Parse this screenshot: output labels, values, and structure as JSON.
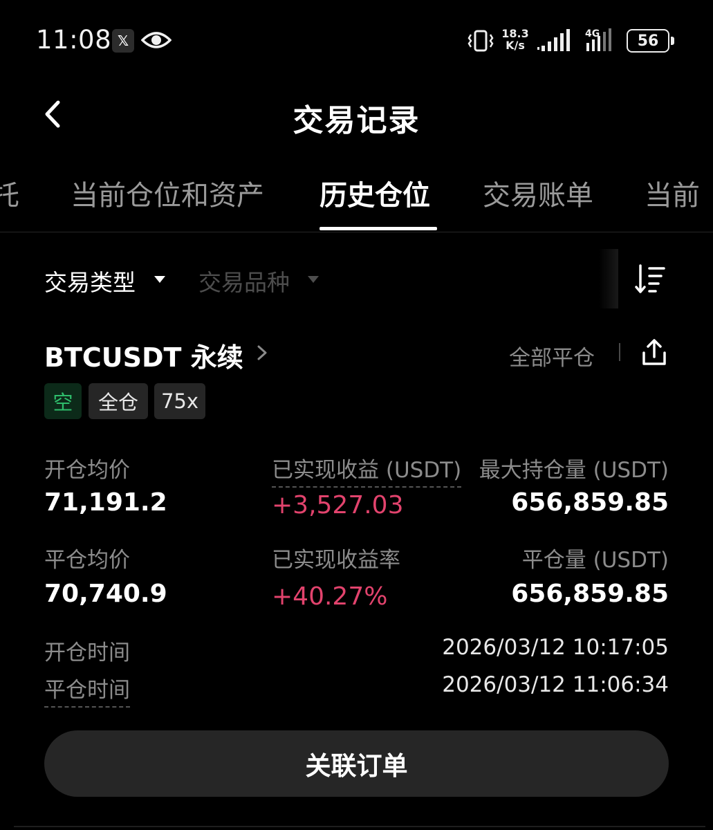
{
  "status_bar": {
    "time": "11:08",
    "app_badge": "𝕏",
    "net_speed_value": "18.3",
    "net_speed_unit": "K/s",
    "network_type": "4G",
    "battery": "56"
  },
  "header": {
    "title": "交易记录",
    "back_icon": "chevron-left-icon"
  },
  "tabs": [
    {
      "label": "托",
      "active": false
    },
    {
      "label": "当前仓位和资产",
      "active": false
    },
    {
      "label": "历史仓位",
      "active": true
    },
    {
      "label": "交易账单",
      "active": false
    },
    {
      "label": "当前",
      "active": false
    }
  ],
  "filters": {
    "trade_type": "交易类型",
    "trade_symbol": "交易品种",
    "sort_icon": "sort-descending-icon"
  },
  "position": {
    "symbol": "BTCUSDT 永续",
    "close_all": "全部平仓",
    "tags": [
      "空",
      "全仓",
      "75x"
    ],
    "open_avg_price_label": "开仓均价",
    "open_avg_price": "71,191.2",
    "realized_pnl_label": "已实现收益 (USDT)",
    "realized_pnl": "+3,527.03",
    "max_position_label": "最大持仓量 (USDT)",
    "max_position": "656,859.85",
    "close_avg_price_label": "平仓均价",
    "close_avg_price": "70,740.9",
    "realized_pnl_rate_label": "已实现收益率",
    "realized_pnl_rate": "+40.27%",
    "closed_volume_label": "平仓量 (USDT)",
    "closed_volume": "656,859.85",
    "open_time_label": "开仓时间",
    "open_time": "2026/03/12 10:17:05",
    "close_time_label": "平仓时间",
    "close_time": "2026/03/12 11:06:34"
  },
  "actions": {
    "linked_orders": "关联订单"
  },
  "colors": {
    "background": "#000000",
    "pnl_positive": "#e2436d",
    "short_tag": "#2ebd6b"
  }
}
